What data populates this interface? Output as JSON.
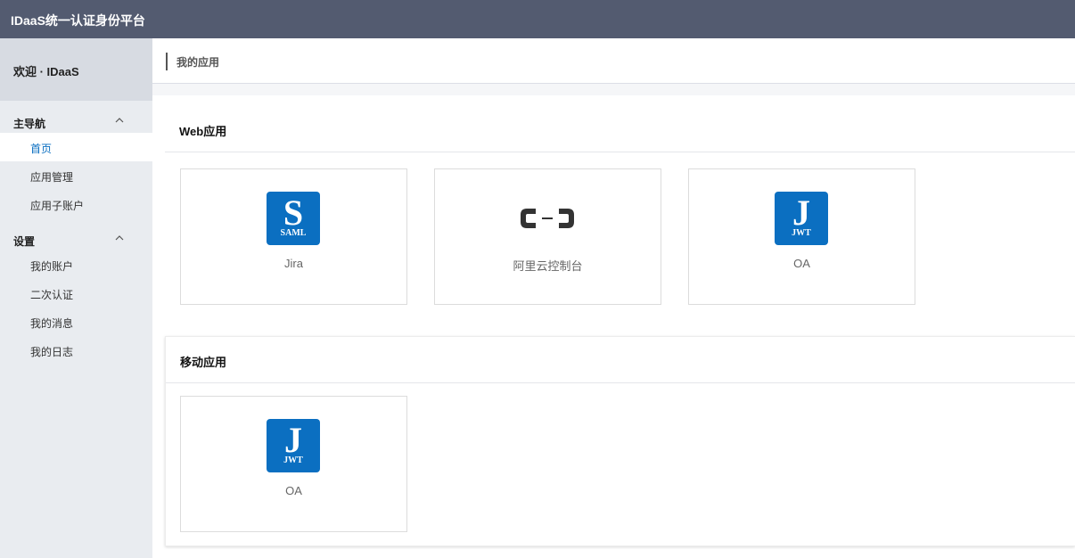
{
  "header": {
    "title": "IDaaS统一认证身份平台"
  },
  "sidebar": {
    "welcome": "欢迎 · IDaaS",
    "groups": [
      {
        "label": "主导航",
        "items": [
          "首页",
          "应用管理",
          "应用子账户"
        ]
      },
      {
        "label": "设置",
        "items": [
          "我的账户",
          "二次认证",
          "我的消息",
          "我的日志"
        ]
      }
    ],
    "active_item": "首页"
  },
  "breadcrumb": "我的应用",
  "sections": [
    {
      "title": "Web应用",
      "apps": [
        {
          "name": "Jira",
          "icon": "saml-icon",
          "icon_letter": "S",
          "icon_sub": "SAML"
        },
        {
          "name": "阿里云控制台",
          "icon": "aliyun-logo-icon"
        },
        {
          "name": "OA",
          "icon": "jwt-icon",
          "icon_letter": "J",
          "icon_sub": "JWT"
        }
      ]
    },
    {
      "title": "移动应用",
      "apps": [
        {
          "name": "OA",
          "icon": "jwt-icon",
          "icon_letter": "J",
          "icon_sub": "JWT"
        }
      ]
    }
  ],
  "colors": {
    "topbar": "#535b70",
    "accent": "#0b6fc1",
    "sidebar": "#e9ecf0"
  }
}
